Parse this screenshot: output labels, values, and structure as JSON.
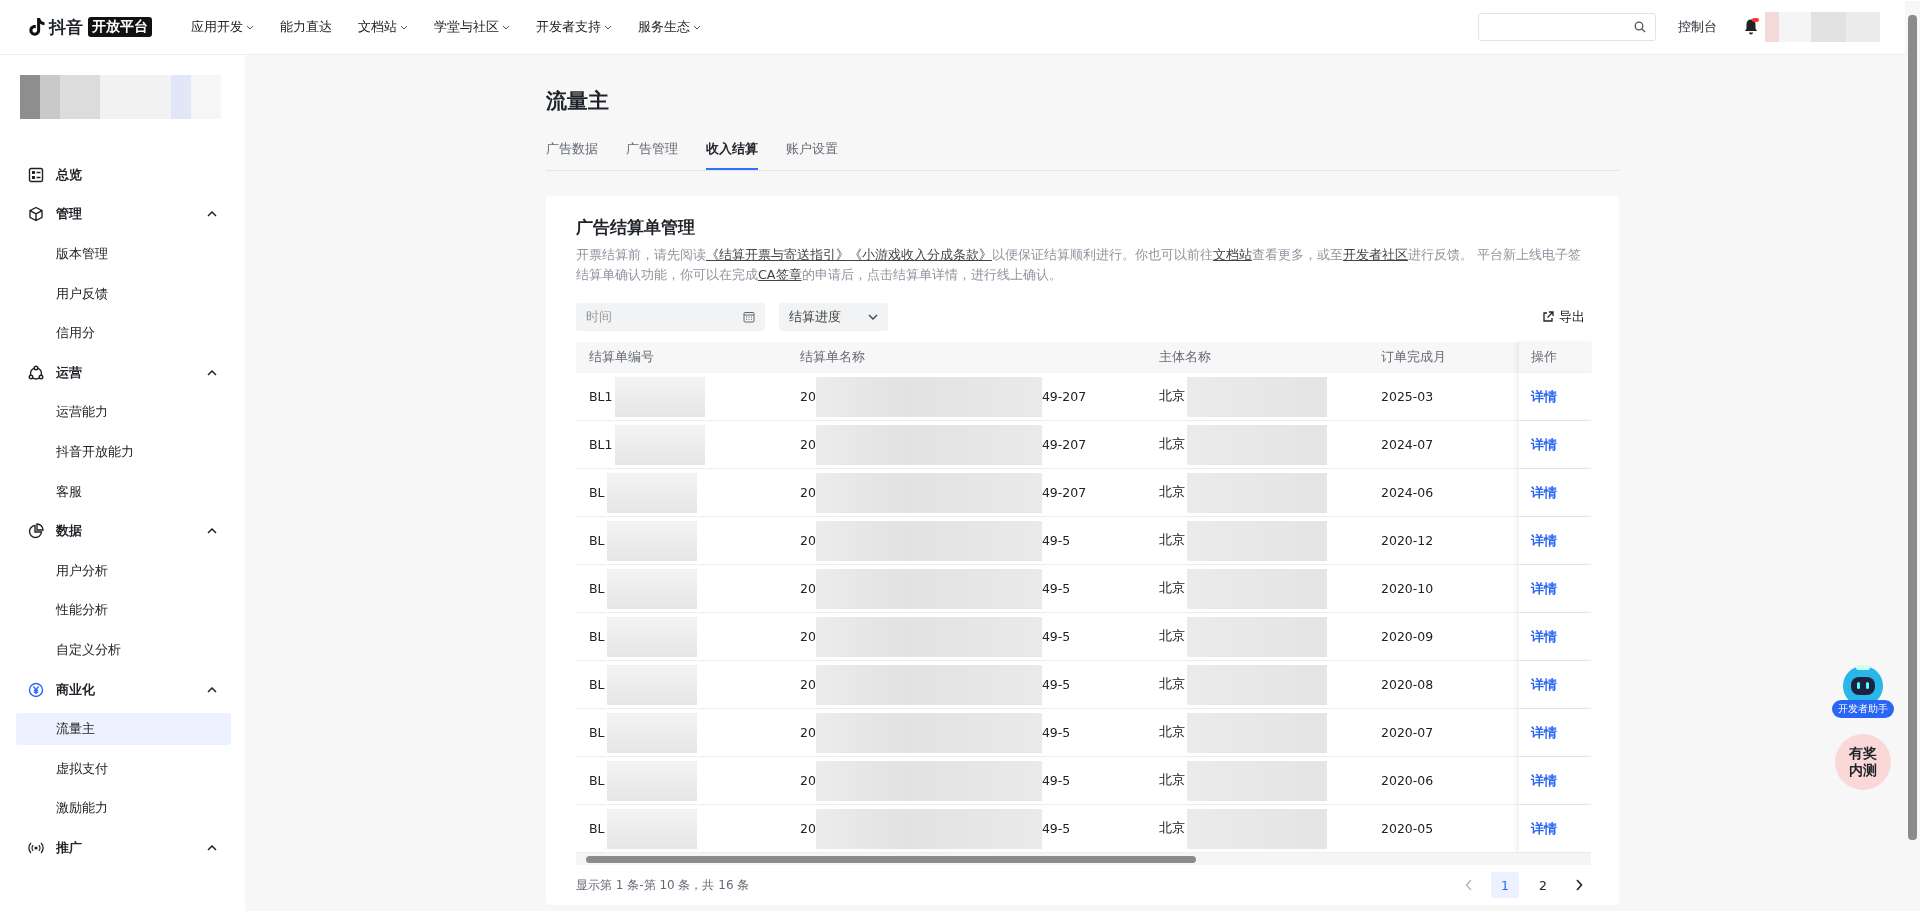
{
  "topbar": {
    "logo_text": "抖音",
    "logo_badge": "开放平台",
    "nav": [
      {
        "label": "应用开发",
        "dropdown": true
      },
      {
        "label": "能力直达",
        "dropdown": false
      },
      {
        "label": "文档站",
        "dropdown": true
      },
      {
        "label": "学堂与社区",
        "dropdown": true
      },
      {
        "label": "开发者支持",
        "dropdown": true
      },
      {
        "label": "服务生态",
        "dropdown": true
      }
    ],
    "console": "控制台"
  },
  "sidebar": {
    "groups": [
      {
        "label": "总览",
        "expanded": false
      },
      {
        "label": "管理",
        "expanded": true,
        "children": [
          {
            "label": "版本管理",
            "selected": false
          },
          {
            "label": "用户反馈",
            "selected": false
          },
          {
            "label": "信用分",
            "selected": false
          }
        ]
      },
      {
        "label": "运营",
        "expanded": true,
        "children": [
          {
            "label": "运营能力",
            "selected": false
          },
          {
            "label": "抖音开放能力",
            "selected": false
          },
          {
            "label": "客服",
            "selected": false
          }
        ]
      },
      {
        "label": "数据",
        "expanded": true,
        "children": [
          {
            "label": "用户分析",
            "selected": false
          },
          {
            "label": "性能分析",
            "selected": false
          },
          {
            "label": "自定义分析",
            "selected": false
          }
        ]
      },
      {
        "label": "商业化",
        "expanded": true,
        "children": [
          {
            "label": "流量主",
            "selected": true
          },
          {
            "label": "虚拟支付",
            "selected": false
          },
          {
            "label": "激励能力",
            "selected": false
          }
        ]
      },
      {
        "label": "推广",
        "expanded": true
      }
    ]
  },
  "page": {
    "title": "流量主",
    "tabs": [
      {
        "label": "广告数据",
        "selected": false
      },
      {
        "label": "广告管理",
        "selected": false
      },
      {
        "label": "收入结算",
        "selected": true
      },
      {
        "label": "账户设置",
        "selected": false
      }
    ]
  },
  "card": {
    "title": "广告结算单管理",
    "description": [
      {
        "text": "开票结算前，请先阅读",
        "link": false
      },
      {
        "text": "《结算开票与寄送指引》《小游戏收入分成条款》",
        "link": true
      },
      {
        "text": "以便保证结算顺利进行。你也可以前往",
        "link": false
      },
      {
        "text": "文档站",
        "link": true
      },
      {
        "text": "查看更多，或至",
        "link": false
      },
      {
        "text": "开发者社区",
        "link": true
      },
      {
        "text": "进行反馈。 平台新上线电子签结算单确认功能，你可以在完成",
        "link": false
      },
      {
        "text": "CA签章",
        "link": true
      },
      {
        "text": "的申请后，点击结算单详情，进行线上确认。",
        "link": false
      }
    ],
    "filters": {
      "time_placeholder": "时间",
      "progress_placeholder": "结算进度",
      "export": "导出"
    },
    "table": {
      "columns": [
        "结算单编号",
        "结算单名称",
        "主体名称",
        "订单完成月",
        "操作"
      ],
      "rows": [
        {
          "id": "BL1",
          "name_start": "20",
          "name_end": "49-207",
          "entity": "北京",
          "month": "2025-03",
          "action": "详情"
        },
        {
          "id": "BL1",
          "name_start": "20",
          "name_end": "49-207",
          "entity": "北京",
          "month": "2024-07",
          "action": "详情"
        },
        {
          "id": "BL",
          "name_start": "20",
          "name_end": "49-207",
          "entity": "北京",
          "month": "2024-06",
          "action": "详情"
        },
        {
          "id": "BL",
          "name_start": "20",
          "name_end": "49-5",
          "entity": "北京",
          "month": "2020-12",
          "action": "详情"
        },
        {
          "id": "BL",
          "name_start": "20",
          "name_end": "49-5",
          "entity": "北京",
          "month": "2020-10",
          "action": "详情"
        },
        {
          "id": "BL",
          "name_start": "20",
          "name_end": "49-5",
          "entity": "北京",
          "month": "2020-09",
          "action": "详情"
        },
        {
          "id": "BL",
          "name_start": "20",
          "name_end": "49-5",
          "entity": "北京",
          "month": "2020-08",
          "action": "详情"
        },
        {
          "id": "BL",
          "name_start": "20",
          "name_end": "49-5",
          "entity": "北京",
          "month": "2020-07",
          "action": "详情"
        },
        {
          "id": "BL",
          "name_start": "20",
          "name_end": "49-5",
          "entity": "北京",
          "month": "2020-06",
          "action": "详情"
        },
        {
          "id": "BL",
          "name_start": "20",
          "name_end": "49-5",
          "entity": "北京",
          "month": "2020-05",
          "action": "详情"
        }
      ]
    },
    "pagination": {
      "summary": "显示第 1 条-第 10 条，共 16 条",
      "pages": [
        {
          "label": "1",
          "selected": true
        },
        {
          "label": "2",
          "selected": false
        }
      ]
    }
  },
  "floating": {
    "assistant_label": "开发者助手",
    "beta_label": "有奖内测"
  }
}
